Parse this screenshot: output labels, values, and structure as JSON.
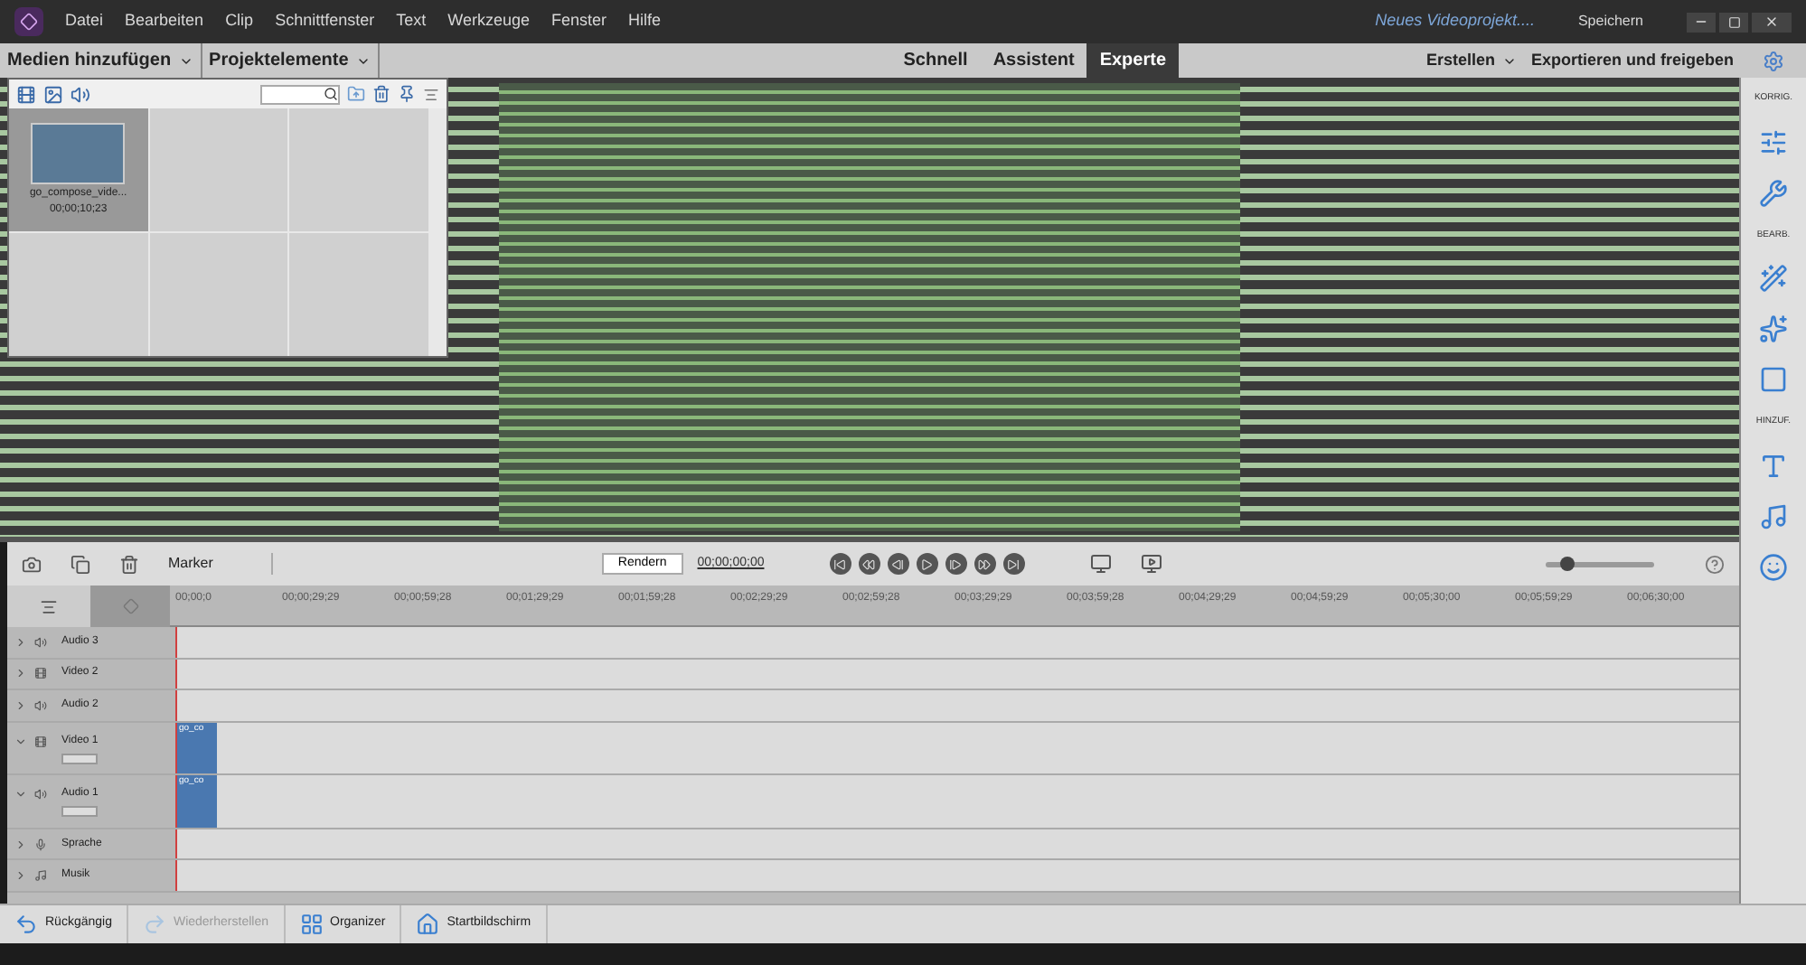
{
  "title_bar": {
    "menu": [
      "Datei",
      "Bearbeiten",
      "Clip",
      "Schnittfenster",
      "Text",
      "Werkzeuge",
      "Fenster",
      "Hilfe"
    ],
    "project_name": "Neues Videoprojekt....",
    "save": "Speichern"
  },
  "toolbar": {
    "menus": [
      "Medien hinzufügen",
      "Projektelemente"
    ],
    "modes": [
      {
        "label": "Schnell",
        "selected": false
      },
      {
        "label": "Assistent",
        "selected": false
      },
      {
        "label": "Experte",
        "selected": true
      }
    ],
    "create": "Erstellen",
    "export": "Exportieren und freigeben"
  },
  "project_panel": {
    "clips": [
      {
        "name": "go_compose_vide...",
        "duration": "00;00;10;23",
        "selected": true
      }
    ]
  },
  "right_panel": {
    "sections": [
      {
        "label": "KORRIG."
      },
      {
        "label": "BEARB."
      },
      {
        "label": "HINZUF."
      }
    ]
  },
  "timeline": {
    "marker": "Marker",
    "render": "Rendern",
    "timecode": "00;00;00;00",
    "zoom": {
      "level": 0.2
    },
    "ruler": [
      "00;00;0",
      "00;00;29;29",
      "00;00;59;28",
      "00;01;29;29",
      "00;01;59;28",
      "00;02;29;29",
      "00;02;59;28",
      "00;03;29;29",
      "00;03;59;28",
      "00;04;29;29",
      "00;04;59;29",
      "00;05;30;00",
      "00;05;59;29",
      "00;06;30;00"
    ],
    "tracks": [
      {
        "name": "Audio 3",
        "kind": "audio",
        "expanded": false
      },
      {
        "name": "Video 2",
        "kind": "video",
        "expanded": false
      },
      {
        "name": "Audio 2",
        "kind": "audio",
        "expanded": false
      },
      {
        "name": "Video 1",
        "kind": "video",
        "expanded": true,
        "clip": "go_co"
      },
      {
        "name": "Audio 1",
        "kind": "audio",
        "expanded": true,
        "clip": "go_co"
      },
      {
        "name": "Sprache",
        "kind": "voice",
        "expanded": false
      },
      {
        "name": "Musik",
        "kind": "music",
        "expanded": false
      }
    ]
  },
  "bottom_bar": [
    {
      "label": "Rückgängig",
      "kind": "undo",
      "disabled": false
    },
    {
      "label": "Wiederherstellen",
      "kind": "redo",
      "disabled": true
    },
    {
      "label": "Organizer",
      "kind": "organizer",
      "disabled": false
    },
    {
      "label": "Startbildschirm",
      "kind": "home",
      "disabled": false
    }
  ]
}
